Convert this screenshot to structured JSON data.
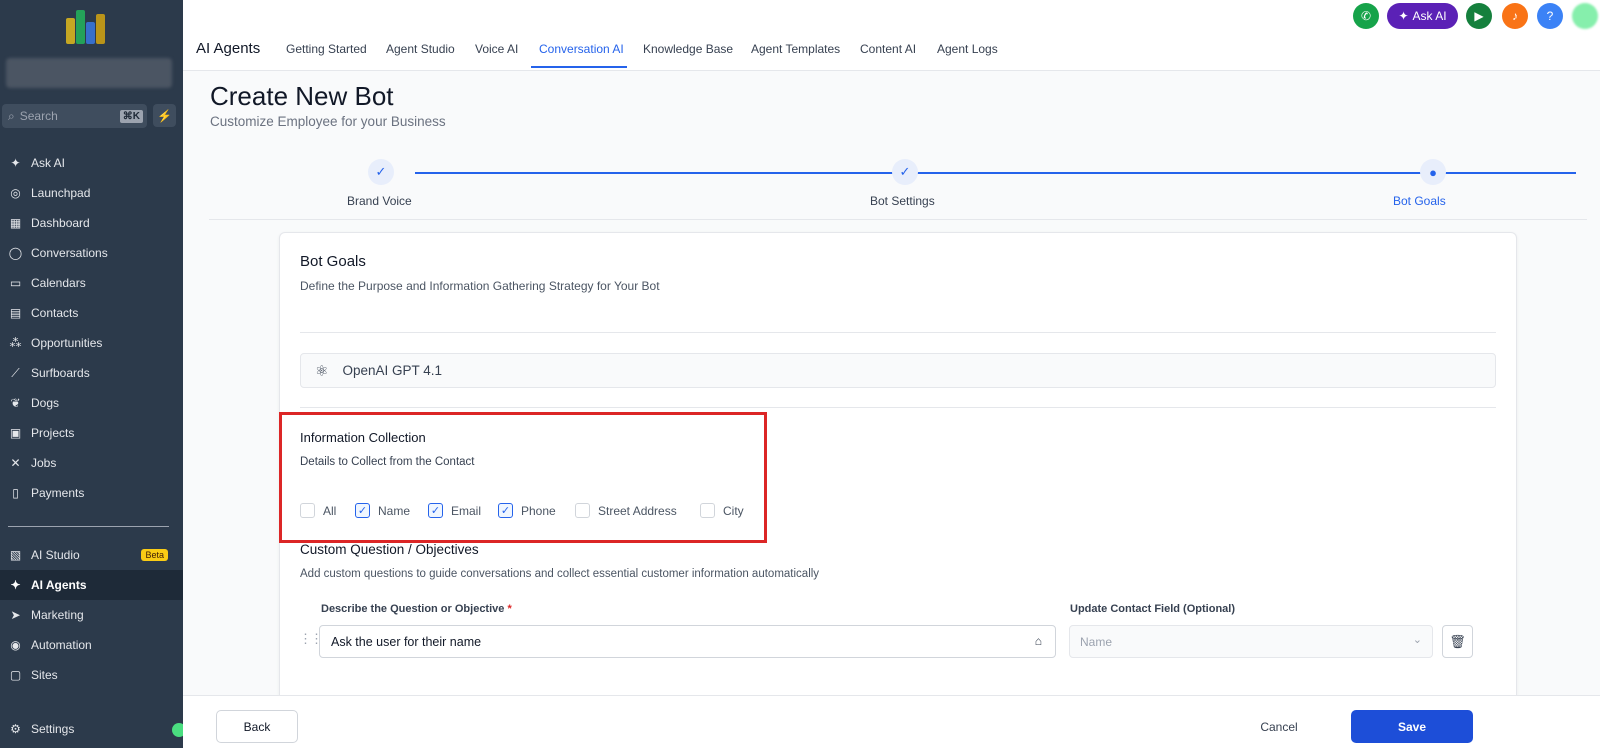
{
  "sidebar": {
    "search_placeholder": "Search",
    "search_shortcut": "⌘K",
    "items": [
      {
        "label": "Ask AI"
      },
      {
        "label": "Launchpad"
      },
      {
        "label": "Dashboard"
      },
      {
        "label": "Conversations"
      },
      {
        "label": "Calendars"
      },
      {
        "label": "Contacts"
      },
      {
        "label": "Opportunities"
      },
      {
        "label": "Surfboards"
      },
      {
        "label": "Dogs"
      },
      {
        "label": "Projects"
      },
      {
        "label": "Jobs"
      },
      {
        "label": "Payments"
      }
    ],
    "items2": [
      {
        "label": "AI Studio",
        "badge": "Beta"
      },
      {
        "label": "AI Agents"
      },
      {
        "label": "Marketing"
      },
      {
        "label": "Automation"
      },
      {
        "label": "Sites"
      }
    ],
    "settings_label": "Settings"
  },
  "header": {
    "title": "AI Agents",
    "tabs": [
      "Getting Started",
      "Agent Studio",
      "Voice AI",
      "Conversation AI",
      "Knowledge Base",
      "Agent Templates",
      "Content AI",
      "Agent Logs"
    ],
    "active_tab": "Conversation AI",
    "ask_ai_label": "Ask AI",
    "help_label": "?"
  },
  "page": {
    "title": "Create New Bot",
    "subtitle": "Customize Employee for your Business"
  },
  "steps": [
    {
      "label": "Brand Voice",
      "status": "done"
    },
    {
      "label": "Bot Settings",
      "status": "done"
    },
    {
      "label": "Bot Goals",
      "status": "active"
    }
  ],
  "card": {
    "title": "Bot Goals",
    "subtitle": "Define the Purpose and Information Gathering Strategy for Your Bot",
    "model": "OpenAI GPT 4.1",
    "info_title": "Information Collection",
    "info_subtitle": "Details to Collect from the Contact",
    "checkboxes": [
      {
        "label": "All",
        "checked": false
      },
      {
        "label": "Name",
        "checked": true
      },
      {
        "label": "Email",
        "checked": true
      },
      {
        "label": "Phone",
        "checked": true
      },
      {
        "label": "Street Address",
        "checked": false
      },
      {
        "label": "City",
        "checked": false
      }
    ],
    "custom_title": "Custom Question / Objectives",
    "custom_subtitle": "Add custom questions to guide conversations and collect essential customer information automatically",
    "question_label": "Describe the Question or Objective",
    "question_required": "*",
    "question_value": "Ask the user for their name",
    "field_label": "Update Contact Field (Optional)",
    "field_placeholder": "Name"
  },
  "footer": {
    "back_label": "Back",
    "cancel_label": "Cancel",
    "save_label": "Save"
  },
  "colors": {
    "sidebar_bg": "#2c3a4b",
    "accent": "#2563eb",
    "save_button": "#1d4ed8",
    "highlight_border": "#dc2626"
  }
}
